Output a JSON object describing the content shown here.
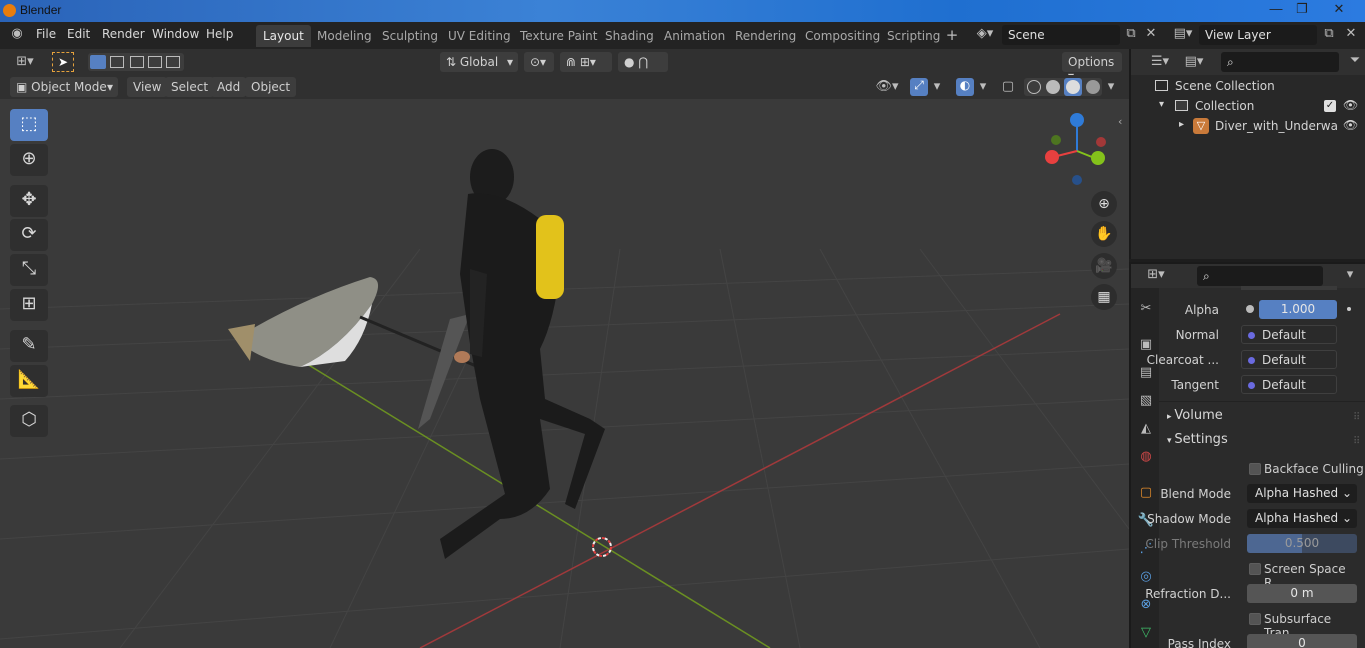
{
  "window": {
    "app_title": "Blender",
    "min": "—",
    "max": "❐",
    "close": "✕"
  },
  "menu": [
    "File",
    "Edit",
    "Render",
    "Window",
    "Help"
  ],
  "workspaces": [
    "Layout",
    "Modeling",
    "Sculpting",
    "UV Editing",
    "Texture Paint",
    "Shading",
    "Animation",
    "Rendering",
    "Compositing",
    "Scripting"
  ],
  "workspace_add": "+",
  "scene": {
    "label": "Scene"
  },
  "view_layer": {
    "label": "View Layer"
  },
  "toolbar": {
    "transform": "Global",
    "options": "Options"
  },
  "viewport_header": {
    "mode": "Object Mode",
    "menus": [
      "View",
      "Select",
      "Add",
      "Object"
    ]
  },
  "gizmo": {
    "x": "#e8403f",
    "y": "#84c21b",
    "z": "#2f7bd8"
  },
  "outliner": {
    "scene_collection": "Scene Collection",
    "collection": "Collection",
    "object": "Diver_with_Underwa"
  },
  "properties": {
    "alpha": {
      "label": "Alpha",
      "value": "1.000"
    },
    "normal": {
      "label": "Normal",
      "value": "Default"
    },
    "clearcoat": {
      "label": "Clearcoat ...",
      "value": "Default"
    },
    "tangent": {
      "label": "Tangent",
      "value": "Default"
    },
    "volume_section": "Volume",
    "settings_section": "Settings",
    "backface_culling": "Backface Culling",
    "blend_mode": {
      "label": "Blend Mode",
      "value": "Alpha Hashed"
    },
    "shadow_mode": {
      "label": "Shadow Mode",
      "value": "Alpha Hashed"
    },
    "clip_threshold": {
      "label": "Clip Threshold",
      "value": "0.500"
    },
    "screen_space": "Screen Space R...",
    "refraction": {
      "label": "Refraction D...",
      "value": "0 m"
    },
    "subsurface": "Subsurface Tran...",
    "pass_index": {
      "label": "Pass Index",
      "value": "0"
    }
  }
}
